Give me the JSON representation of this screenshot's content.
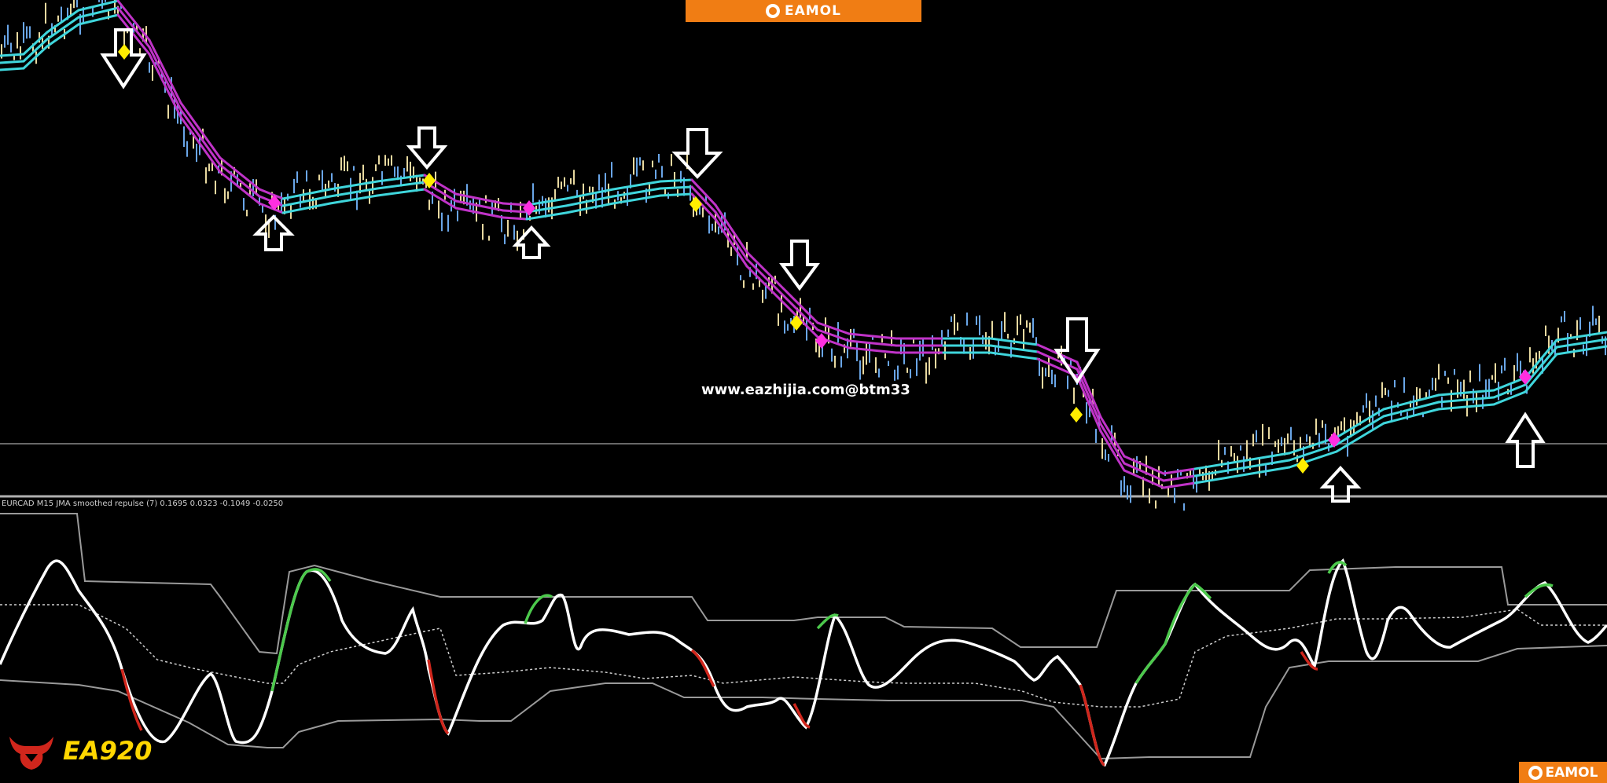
{
  "banner": {
    "brand": "EAMOL"
  },
  "bottom_brand": {
    "brand": "EAMOL"
  },
  "watermark": {
    "text": "www.eazhijia.com@btm33"
  },
  "indicator": {
    "label": "EURCAD M15 JMA smoothed repulse (7) 0.1695 0.0323 -0.1049 -0.0250"
  },
  "logo": {
    "text": "EA920"
  },
  "colors": {
    "background": "#000000",
    "band_up": "#3fd6dc",
    "band_down": "#c033c8",
    "signal_diamond_buy": "#ff2fe0",
    "signal_diamond_sell": "#ffee00",
    "oscillator_line": "#ffffff",
    "oscillator_up": "#4cc94c",
    "oscillator_down": "#d0261c",
    "levels": "#9a9a9a",
    "banner": "#f07d14",
    "logo_text": "#ffd700"
  },
  "icons": [
    "arrow-down-icon",
    "arrow-up-icon",
    "diamond-icon",
    "bull-logo-icon"
  ]
}
